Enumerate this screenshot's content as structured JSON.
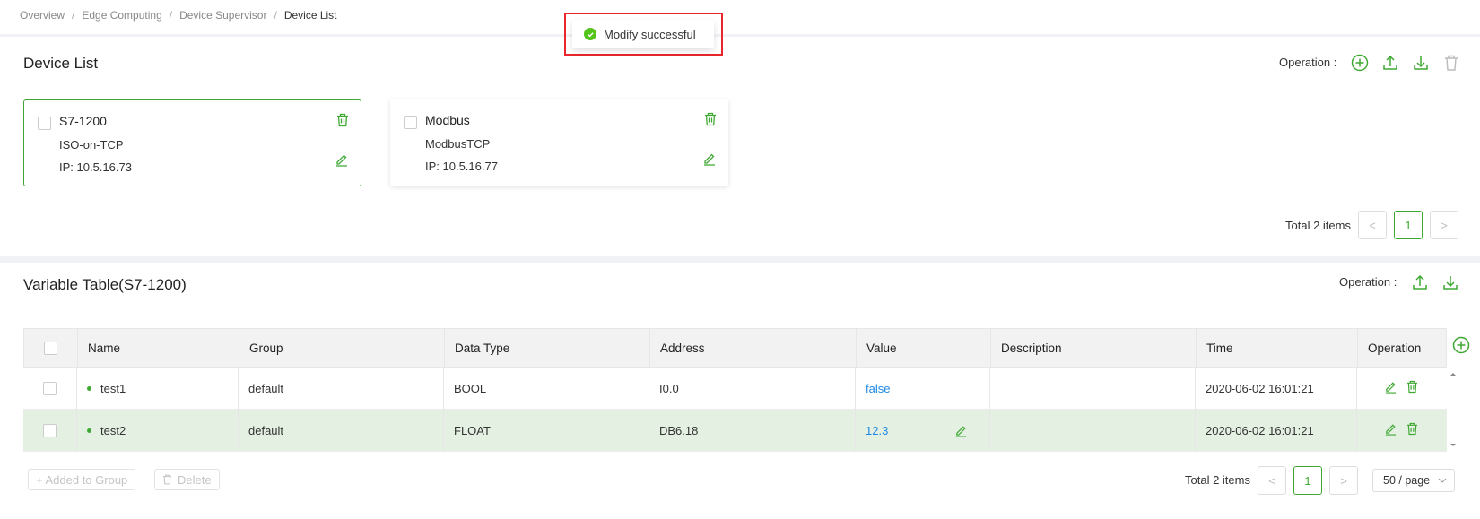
{
  "breadcrumb": [
    "Overview",
    "Edge Computing",
    "Device Supervisor",
    "Device List"
  ],
  "toast": {
    "message": "Modify successful",
    "status": "success"
  },
  "device_list": {
    "title": "Device List",
    "operation_label": "Operation :",
    "cards": [
      {
        "name": "S7-1200",
        "protocol": "ISO-on-TCP",
        "ip": "IP: 10.5.16.73",
        "selected": true
      },
      {
        "name": "Modbus",
        "protocol": "ModbusTCP",
        "ip": "IP: 10.5.16.77",
        "selected": false
      }
    ],
    "pagination": {
      "total": "Total 2 items",
      "current_page": "1",
      "prev": "<",
      "next": ">"
    }
  },
  "variable_table": {
    "title": "Variable Table(S7-1200)",
    "operation_label": "Operation :",
    "columns": [
      "Name",
      "Group",
      "Data Type",
      "Address",
      "Value",
      "Description",
      "Time",
      "Operation"
    ],
    "rows": [
      {
        "name": "test1",
        "group": "default",
        "data_type": "BOOL",
        "address": "I0.0",
        "value": "false",
        "description": "",
        "time": "2020-06-02 16:01:21"
      },
      {
        "name": "test2",
        "group": "default",
        "data_type": "FLOAT",
        "address": "DB6.18",
        "value": "12.3",
        "description": "",
        "time": "2020-06-02 16:01:21"
      }
    ],
    "footer": {
      "add_group_label": "+ Added to Group",
      "delete_label": "Delete",
      "total": "Total 2 items",
      "current_page": "1",
      "prev": "<",
      "next": ">",
      "page_size": "50 / page"
    }
  },
  "colors": {
    "accent": "#3fa833",
    "value_blue": "#1e88e5",
    "toast_frame": "#e8262b",
    "row_highlight": "#e4f1e2"
  }
}
